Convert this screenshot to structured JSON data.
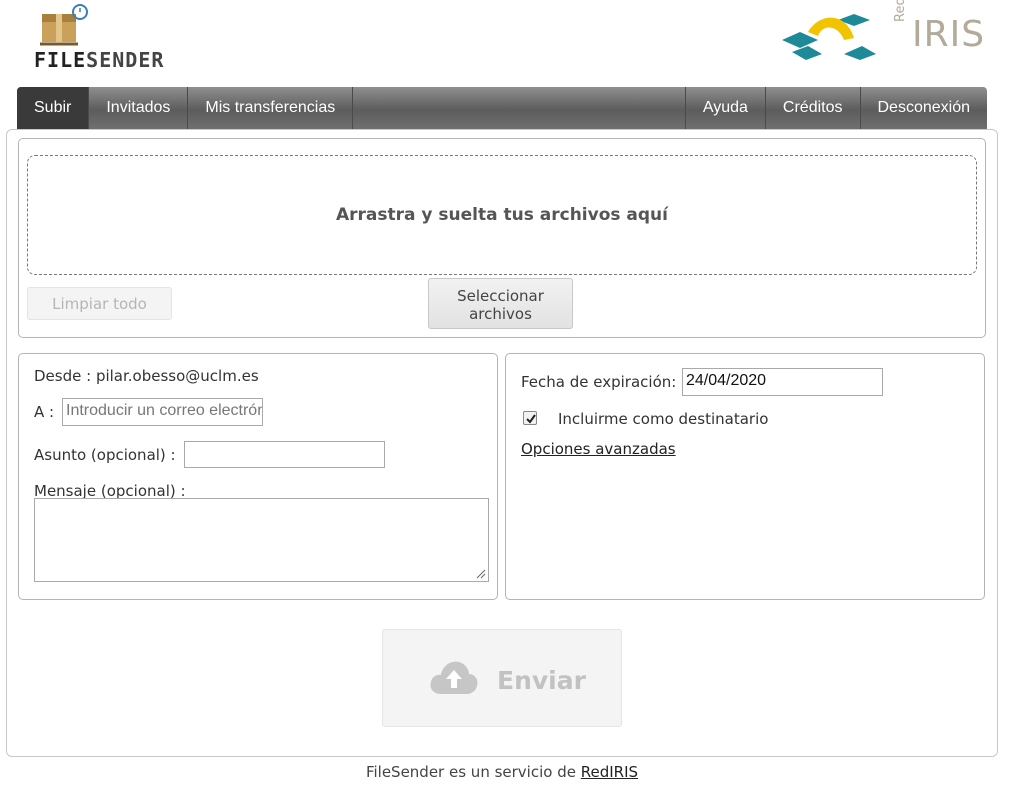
{
  "header": {
    "logo_text_dark": "FILE",
    "logo_text_light": "SENDER",
    "partner_red": "Red",
    "partner_iris": "IRIS"
  },
  "nav": {
    "left": [
      "Subir",
      "Invitados",
      "Mis transferencias"
    ],
    "right": [
      "Ayuda",
      "Créditos",
      "Desconexión"
    ],
    "active": "Subir"
  },
  "upload": {
    "dropzone_text": "Arrastra y suelta tus archivos aquí",
    "clear_all_label": "Limpiar todo",
    "select_files_line1": "Seleccionar",
    "select_files_line2": "archivos"
  },
  "form": {
    "from_label": "Desde :",
    "from_value": "pilar.obesso@uclm.es",
    "to_label": "A :",
    "to_placeholder": "Introducir un correo electrónico",
    "subject_label": "Asunto (opcional) :",
    "subject_value": "",
    "message_label": "Mensaje (opcional) :",
    "message_value": ""
  },
  "options": {
    "expiry_label": "Fecha de expiración:",
    "expiry_value": "24/04/2020",
    "include_me_label": "Incluirme como destinatario",
    "include_me_checked": true,
    "advanced_link": "Opciones avanzadas"
  },
  "send": {
    "label": "Enviar",
    "icon": "cloud-upload-icon"
  },
  "footer": {
    "text": "FileSender es un servicio de ",
    "link": "RedIRIS"
  },
  "colors": {
    "nav_active": "#3a3a3a",
    "disabled_text": "#c2c2c2"
  }
}
